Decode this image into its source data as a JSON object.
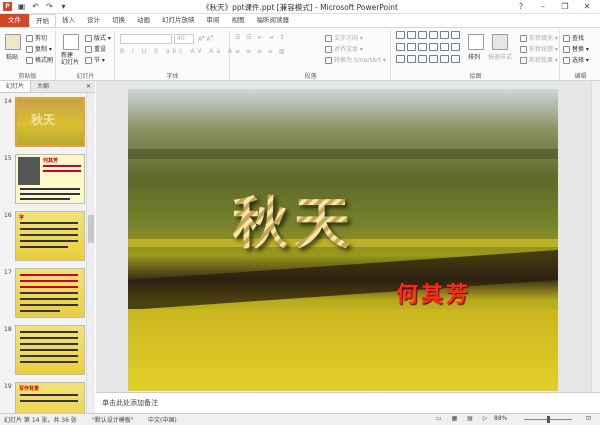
{
  "window": {
    "title": "《秋天》ppt课件.ppt [兼容模式] - Microsoft PowerPoint",
    "controls": [
      "?",
      "–",
      "❐",
      "✕"
    ],
    "quick_access": [
      "save-icon",
      "undo-icon",
      "redo-icon",
      "customize-icon"
    ]
  },
  "tabs": [
    "文件",
    "开始",
    "插入",
    "设计",
    "切换",
    "动画",
    "幻灯片放映",
    "审阅",
    "视图",
    "福昕阅读器"
  ],
  "ribbon": {
    "clipboard": {
      "paste": "粘贴",
      "cut": "剪切",
      "copy": "复制 ▾",
      "format_painter": "格式刷",
      "label": "剪贴板"
    },
    "slides": {
      "new_slide": "新建\n幻灯片",
      "layout": "版式 ▾",
      "reset": "重设",
      "section": "节 ▾",
      "label": "幻灯片"
    },
    "font": {
      "size": "40",
      "label": "字体",
      "buttons": [
        "B",
        "I",
        "U",
        "S",
        "abc",
        "AV",
        "Aa",
        "A"
      ]
    },
    "paragraph": {
      "text_direction": "文字方向 ▾",
      "align_text": "对齐文本 ▾",
      "smartart": "转换为 SmartArt ▾",
      "label": "段落"
    },
    "drawing": {
      "arrange": "排列",
      "quick_styles": "快速样式",
      "shape_fill": "形状填充 ▾",
      "shape_outline": "形状轮廓 ▾",
      "shape_effects": "形状效果 ▾",
      "label": "绘图"
    },
    "editing": {
      "find": "查找",
      "replace": "替换 ▾",
      "select": "选择 ▾",
      "label": "编辑"
    }
  },
  "left_panel": {
    "tabs": [
      "幻灯片",
      "大纲"
    ],
    "close": "✕",
    "slides": [
      {
        "num": "14",
        "title": "秋天"
      },
      {
        "num": "15",
        "name": "何其芳"
      },
      {
        "num": "16",
        "label": "字"
      },
      {
        "num": "17",
        "label": ""
      },
      {
        "num": "18",
        "label": ""
      },
      {
        "num": "19",
        "label": "写作背景"
      }
    ]
  },
  "slide": {
    "title": "秋天",
    "author": "何其芳"
  },
  "notes": {
    "placeholder": "单击此处添加备注"
  },
  "status": {
    "slide_info": "幻灯片 第 14 张，共 36 张",
    "theme": "\"默认设计模板\"",
    "language": "中文(中国)",
    "zoom": "88%"
  }
}
